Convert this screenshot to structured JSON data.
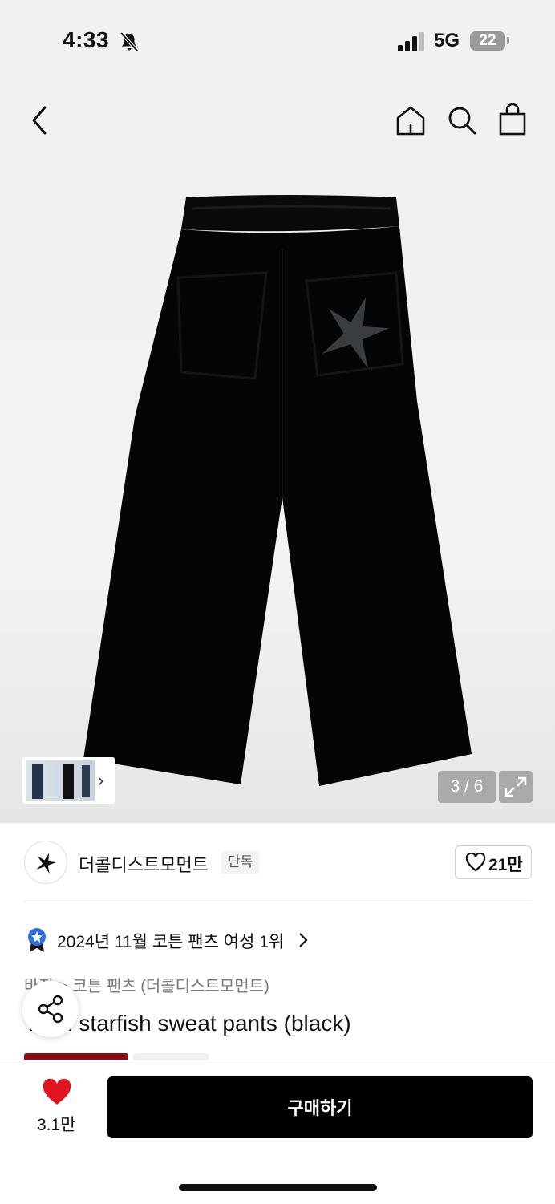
{
  "status_bar": {
    "time": "4:33",
    "network": "5G",
    "battery": "22"
  },
  "nav": {
    "back_icon": "chevron-left-icon",
    "home_icon": "home-icon",
    "search_icon": "search-icon",
    "cart_icon": "shopping-bag-icon"
  },
  "gallery": {
    "counter": "3 / 6",
    "thumb_chevron": "›"
  },
  "brand": {
    "name": "더콜디스트모먼트",
    "badge": "단독",
    "likes": "21만"
  },
  "ranking": {
    "text": "2024년 11월 코튼 팬츠 여성 1위"
  },
  "breadcrumb": {
    "category": "바지",
    "separator": ">",
    "subcategory": "코튼 팬츠 (더콜디스트모먼트)"
  },
  "product": {
    "title": "TCM starfish sweat pants (black)"
  },
  "bottom_bar": {
    "wish_count": "3.1만",
    "buy_label": "구매하기"
  },
  "colors": {
    "accent_red": "#e0141e",
    "brand_bg": "#000000",
    "rank_blue": "#2f6fdc"
  }
}
